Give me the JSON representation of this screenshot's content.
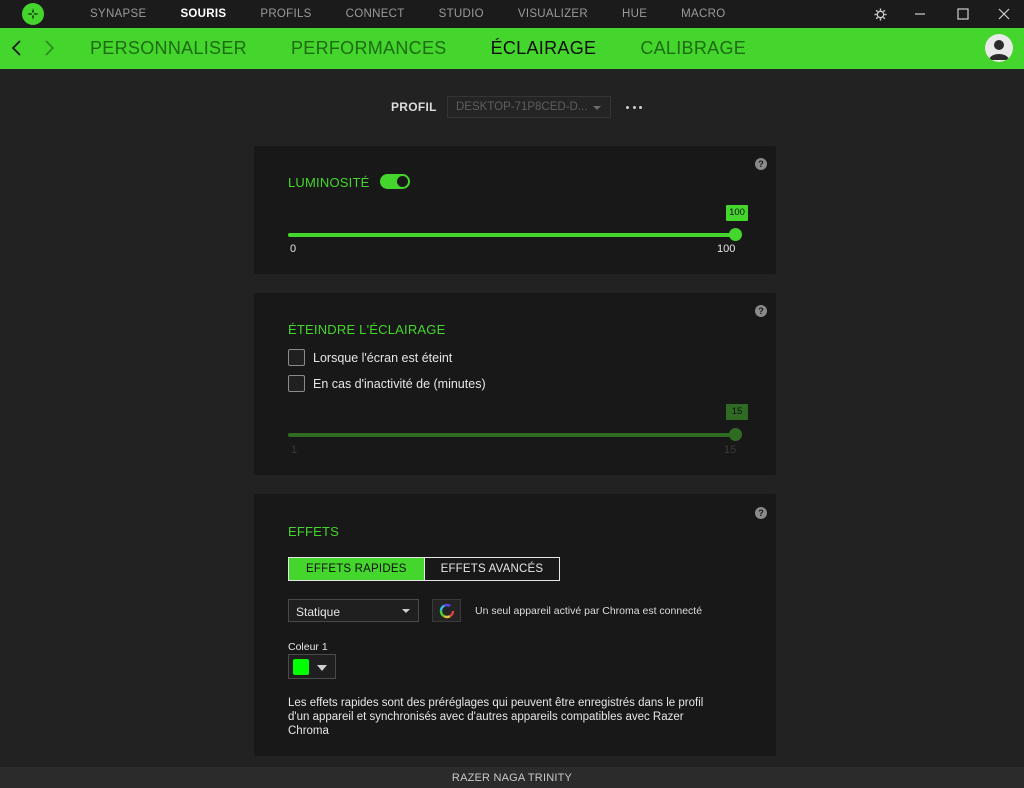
{
  "topnav": {
    "items": [
      {
        "label": "SYNAPSE",
        "active": false
      },
      {
        "label": "SOURIS",
        "active": true
      },
      {
        "label": "PROFILS",
        "active": false
      },
      {
        "label": "CONNECT",
        "active": false
      },
      {
        "label": "STUDIO",
        "active": false
      },
      {
        "label": "VISUALIZER",
        "active": false
      },
      {
        "label": "HUE",
        "active": false
      },
      {
        "label": "MACRO",
        "active": false
      }
    ]
  },
  "subnav": {
    "items": [
      {
        "label": "PERSONNALISER",
        "active": false
      },
      {
        "label": "PERFORMANCES",
        "active": false
      },
      {
        "label": "ÉCLAIRAGE",
        "active": true
      },
      {
        "label": "CALIBRAGE",
        "active": false
      }
    ]
  },
  "profile": {
    "label": "PROFIL",
    "value": "DESKTOP-71P8CED-D..."
  },
  "brightness": {
    "title": "LUMINOSITÉ",
    "enabled": true,
    "value": "100",
    "min_label": "0",
    "max_label": "100",
    "level": 1.0
  },
  "lighting_off": {
    "title": "ÉTEINDRE L'ÉCLAIRAGE",
    "option_screen_off": "Lorsque l'écran est éteint",
    "option_idle": "En cas d'inactivité de (minutes)",
    "value": "15",
    "min_label": "1",
    "max_label": "15",
    "level": 1.0
  },
  "effects": {
    "title": "EFFETS",
    "tab_quick": "EFFETS RAPIDES",
    "tab_advanced": "EFFETS AVANCÉS",
    "selected_effect": "Statique",
    "chroma_note": "Un seul appareil activé par Chroma est connecté",
    "color_label": "Coleur 1",
    "color_value": "#00ff00",
    "description": "Les effets rapides sont des préréglages qui peuvent être enregistrés dans le profil d'un appareil et synchronisés avec d'autres appareils compatibles avec Razer Chroma"
  },
  "help_glyph": "?",
  "footer": {
    "device": "RAZER NAGA TRINITY"
  },
  "colors": {
    "accent": "#44d62c",
    "dim_accent": "#2f6b23",
    "background": "#222222",
    "card": "#181818"
  }
}
